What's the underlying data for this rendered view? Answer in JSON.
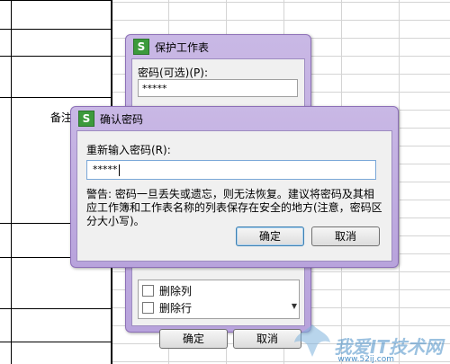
{
  "sheet": {
    "cell_label": "备注"
  },
  "protect_dialog": {
    "title": "保护工作表",
    "password_label": "密码(可选)(P):",
    "password_value": "*****",
    "options": [
      {
        "label": "删除列",
        "checked": false
      },
      {
        "label": "删除行",
        "checked": false
      }
    ],
    "ok_label": "确定",
    "cancel_label": "取消"
  },
  "confirm_dialog": {
    "title": "确认密码",
    "reenter_label": "重新输入密码(R):",
    "reenter_value": "*****",
    "warning": "警告: 密码一旦丢失或遗忘，则无法恢复。建议将密码及其相应工作簿和工作表名称的列表保存在安全的地方(注意，密码区分大小写)。",
    "ok_label": "确定",
    "cancel_label": "取消"
  },
  "watermark": {
    "text": "我爱IT技术网",
    "sub": "www.52ij.com"
  },
  "colors": {
    "dialog_frame": "#b8a3dc",
    "app_icon": "#3c9a3c"
  }
}
